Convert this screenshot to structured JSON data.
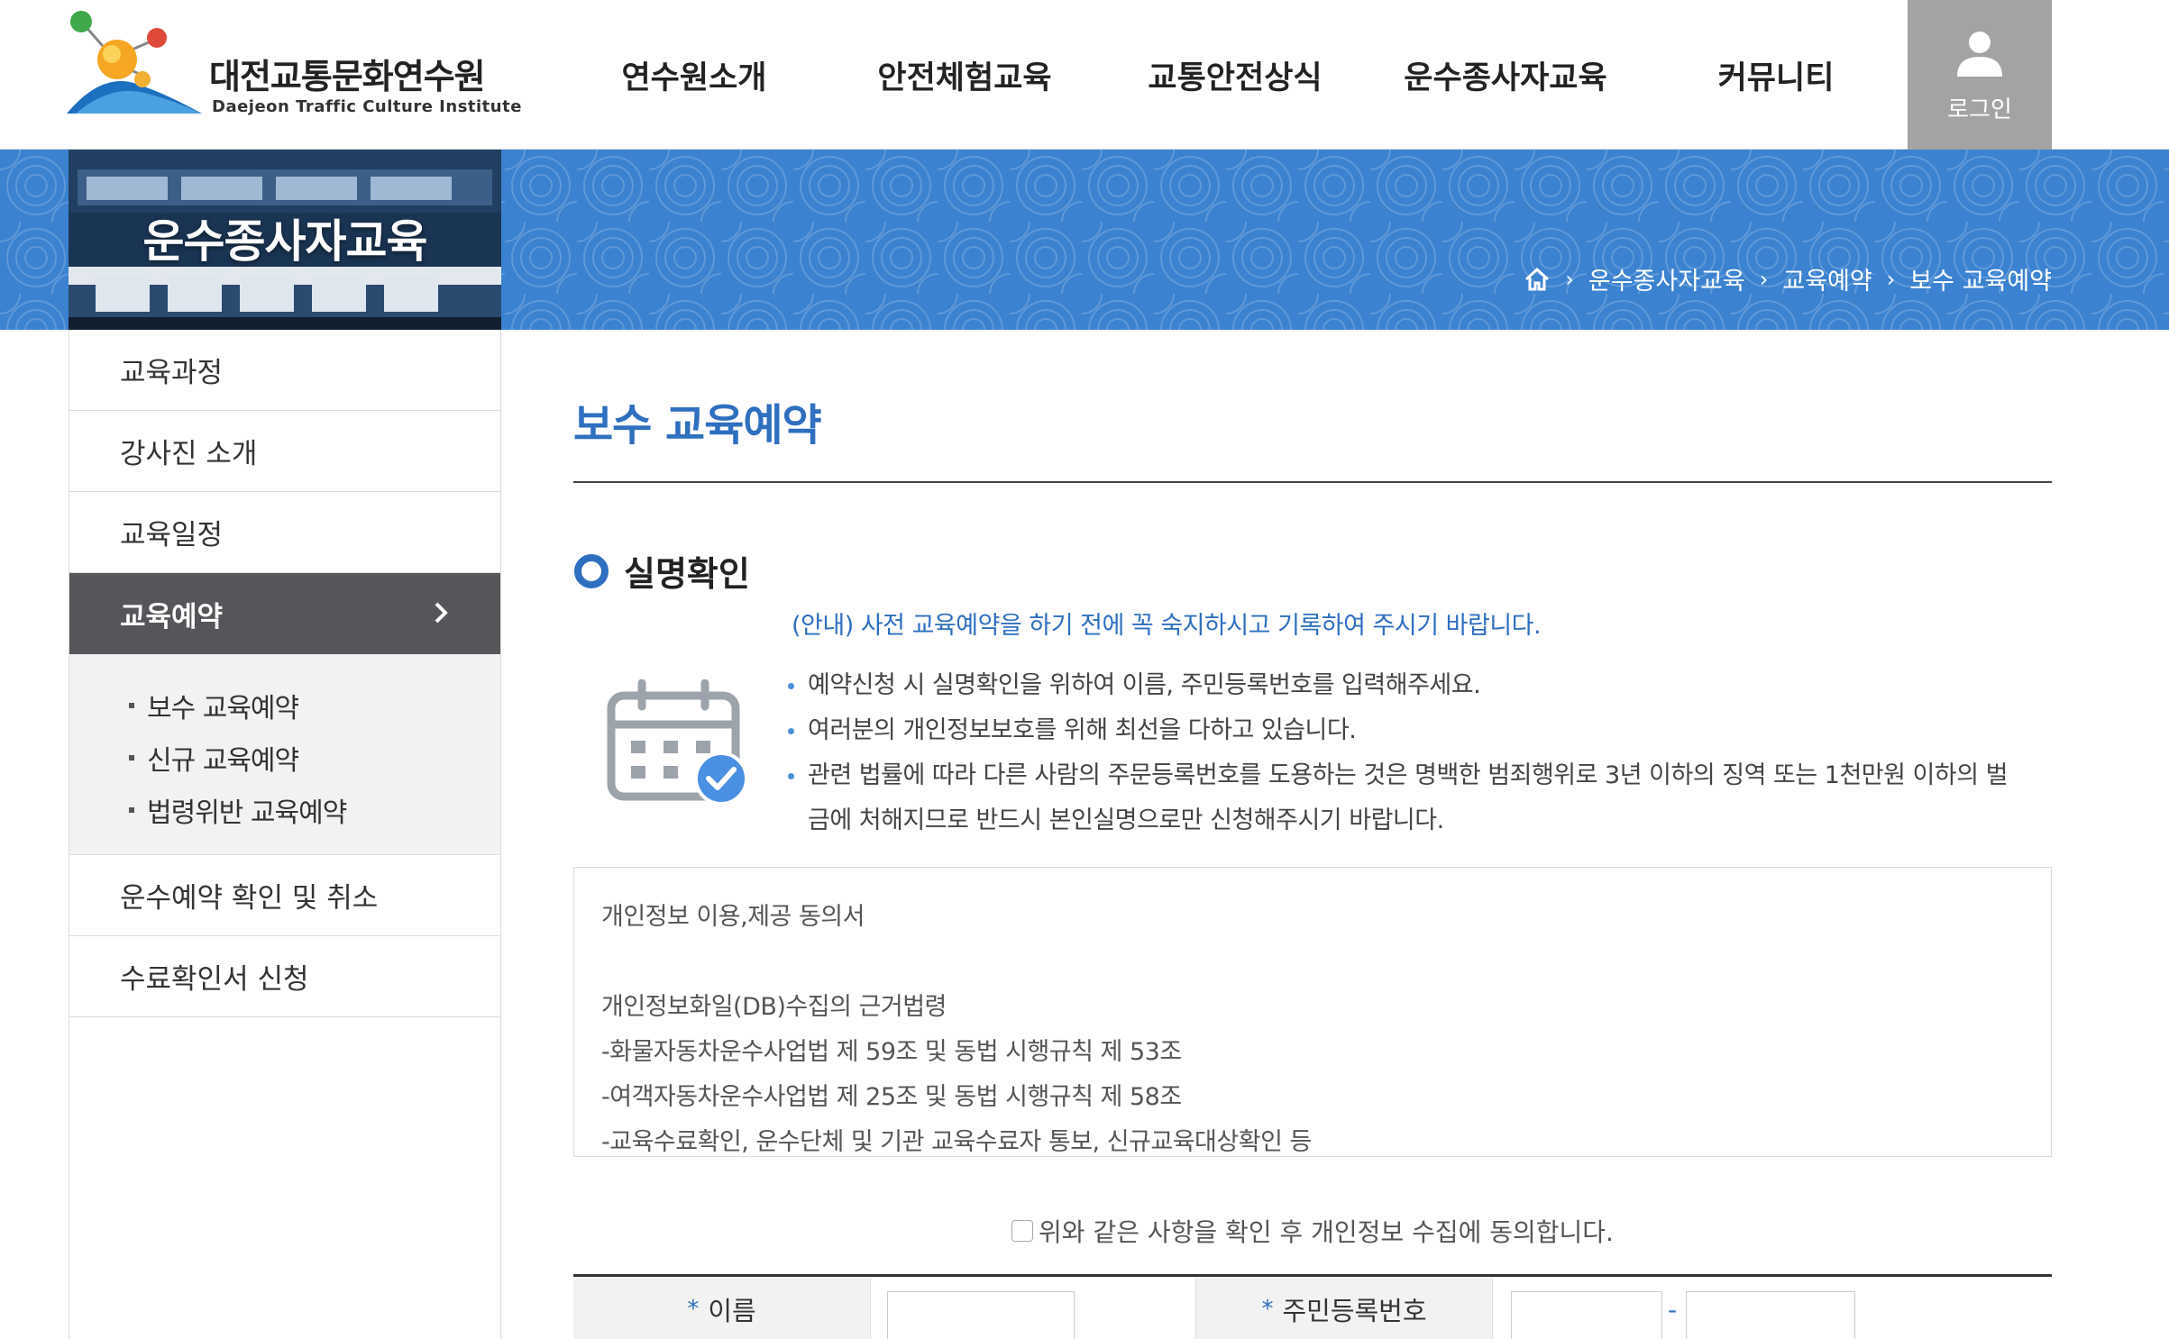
{
  "header": {
    "logo_kr": "대전교통문화연수원",
    "logo_en": "Daejeon Traffic Culture Institute",
    "gnb": [
      "연수원소개",
      "안전체험교육",
      "교통안전상식",
      "운수종사자교육",
      "커뮤니티"
    ],
    "login_label": "로그인"
  },
  "banner": {
    "title": "운수종사자교육",
    "breadcrumb": [
      "운수종사자교육",
      "교육예약",
      "보수 교육예약"
    ]
  },
  "sidebar": {
    "items": [
      "교육과정",
      "강사진 소개",
      "교육일정",
      "교육예약"
    ],
    "sub_items": [
      "보수 교육예약",
      "신규 교육예약",
      "법령위반 교육예약"
    ],
    "bottom_items": [
      "운수예약 확인 및 취소",
      "수료확인서 신청"
    ]
  },
  "content": {
    "page_title": "보수 교육예약",
    "section_title": "실명확인",
    "notice": "(안내) 사전 교육예약을 하기 전에 꼭 숙지하시고 기록하여 주시기 바랍니다.",
    "bullets": [
      "예약신청 시 실명확인을 위하여 이름, 주민등록번호를 입력해주세요.",
      "여러분의 개인정보보호를 위해 최선을 다하고 있습니다.",
      "관련 법률에 따라 다른 사람의 주문등록번호를 도용하는 것은 명백한 범죄행위로 3년 이하의 징역 또는 1천만원 이하의 벌",
      "금에 처해지므로 반드시 본인실명으로만 신청해주시기 바랍니다."
    ],
    "consent_title": "개인정보 이용,제공 동의서",
    "consent_lines": [
      "개인정보화일(DB)수집의 근거법령",
      "-화물자동차운수사업법 제 59조 및 동법 시행규칙 제 53조",
      "-여객자동차운수사업법 제 25조 및 동법 시행규칙 제 58조",
      "-교육수료확인, 운수단체 및 기관 교육수료자 통보, 신규교육대상확인 등"
    ],
    "agree_label": "위와 같은 사항을 확인 후 개인정보 수집에 동의합니다.",
    "form": {
      "required_mark": "*",
      "name_label": "이름",
      "rrn_label": "주민등록번호",
      "rrn_separator": "-"
    }
  },
  "colors": {
    "accent": "#2e6fbf",
    "banner": "#3b82d0",
    "sidebar_active": "#555659"
  }
}
